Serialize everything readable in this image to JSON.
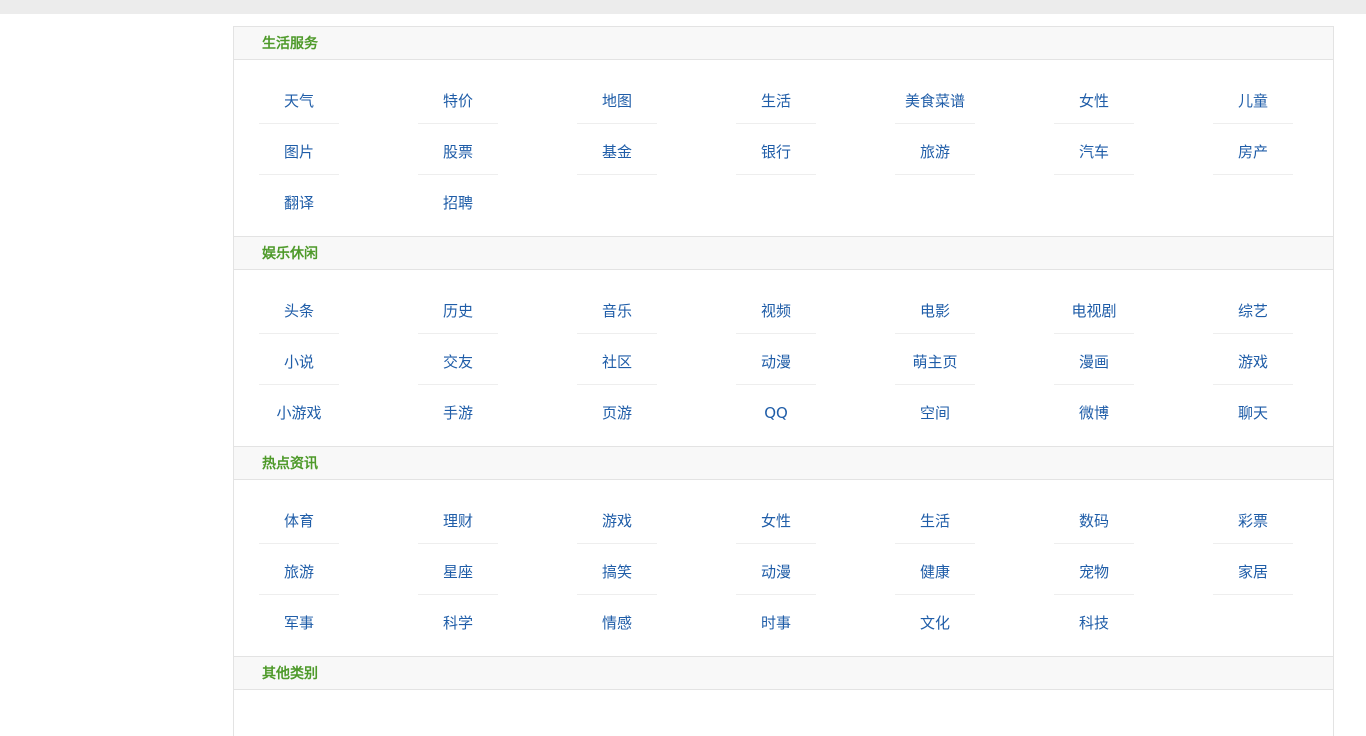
{
  "sections": [
    {
      "title": "生活服务",
      "rows": [
        [
          "天气",
          "特价",
          "地图",
          "生活",
          "美食菜谱",
          "女性",
          "儿童"
        ],
        [
          "图片",
          "股票",
          "基金",
          "银行",
          "旅游",
          "汽车",
          "房产"
        ],
        [
          "翻译",
          "招聘"
        ]
      ]
    },
    {
      "title": "娱乐休闲",
      "rows": [
        [
          "头条",
          "历史",
          "音乐",
          "视频",
          "电影",
          "电视剧",
          "综艺"
        ],
        [
          "小说",
          "交友",
          "社区",
          "动漫",
          "萌主页",
          "漫画",
          "游戏"
        ],
        [
          "小游戏",
          "手游",
          "页游",
          "QQ",
          "空间",
          "微博",
          "聊天"
        ]
      ]
    },
    {
      "title": "热点资讯",
      "rows": [
        [
          "体育",
          "理财",
          "游戏",
          "女性",
          "生活",
          "数码",
          "彩票"
        ],
        [
          "旅游",
          "星座",
          "搞笑",
          "动漫",
          "健康",
          "宠物",
          "家居"
        ],
        [
          "军事",
          "科学",
          "情感",
          "时事",
          "文化",
          "科技"
        ]
      ]
    },
    {
      "title": "其他类别",
      "rows": []
    }
  ],
  "colors": {
    "section_title": "#4e9a2a",
    "link": "#1f5da8"
  }
}
